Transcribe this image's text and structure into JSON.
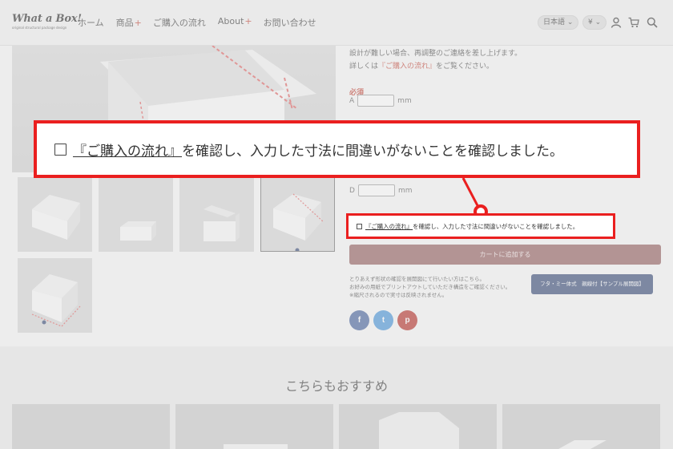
{
  "header": {
    "logo_main": "What a Box!",
    "logo_sub": "original structural package design",
    "nav": [
      {
        "label": "ホーム",
        "plus": ""
      },
      {
        "label": "商品",
        "plus": "+"
      },
      {
        "label": "ご購入の流れ",
        "plus": ""
      },
      {
        "label": "About",
        "plus": "+"
      },
      {
        "label": "お問い合わせ",
        "plus": ""
      }
    ],
    "language": "日本語",
    "currency": "¥"
  },
  "product": {
    "desc_line1": "設計が難しい場合、再調整のご連絡を差し上げます。",
    "desc_line2_prefix": "詳しくは",
    "desc_line2_link": "『ご購入の流れ』",
    "desc_line2_suffix": "をご覧ください。",
    "required_label": "必須",
    "dims": [
      {
        "label": "A",
        "unit": "mm"
      },
      {
        "label": "D",
        "unit": "mm"
      }
    ],
    "confirm_link": "『ご購入の流れ』",
    "confirm_text": "を確認し、入力した寸法に間違いがないことを確認しました。",
    "cart_button": "カートに追加する",
    "note_line1": "とりあえず形状の確認を展開図にて行いたい方はこちら。",
    "note_line2": "お好みの用紙でプリントアウトしていただき構造をご確認ください。",
    "note_line3": "※縮尺されるので実寸は反映されません。",
    "sample_button": "フタ・ミー体式　親線付【サンプル展開図】",
    "social": [
      {
        "name": "facebook",
        "glyph": "f",
        "color": "#3b5998"
      },
      {
        "name": "twitter",
        "glyph": "t",
        "color": "#3d8fd8"
      },
      {
        "name": "pinterest",
        "glyph": "p",
        "color": "#b3261e"
      }
    ]
  },
  "recommended": {
    "title": "こちらもおすすめ"
  },
  "colors": {
    "callout_red": "#ea1f1f",
    "cart_button": "#8e5656",
    "sample_button": "#2c4170",
    "required_red": "#c0392b"
  }
}
